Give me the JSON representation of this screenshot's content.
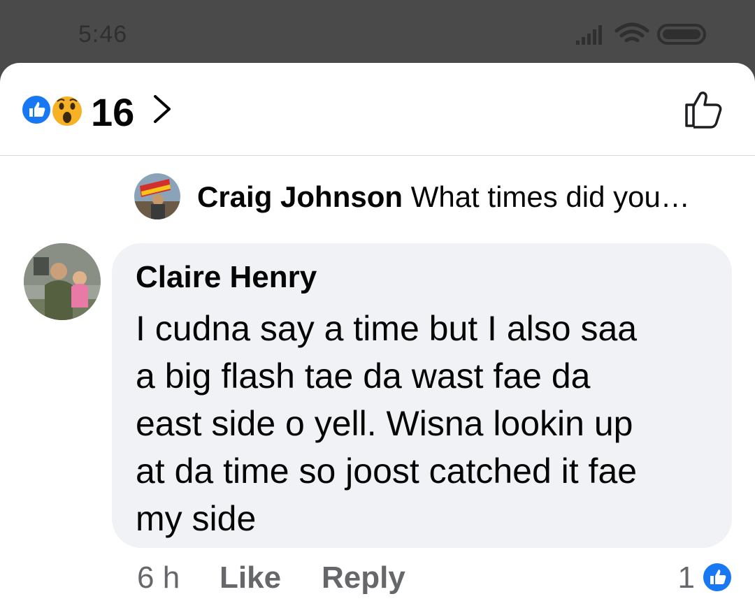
{
  "status_bar": {
    "time": "5:46"
  },
  "reactions": {
    "count": "16",
    "icons": [
      "like-icon",
      "wow-icon"
    ]
  },
  "parent_comment": {
    "author": "Craig Johnson",
    "snippet": "What times did you…"
  },
  "comment": {
    "author": "Claire Henry",
    "lines": [
      "I cudna say a time but I also saa",
      "a big flash tae da wast fae da",
      "east side o yell. Wisna lookin up",
      "at da time so joost catched it fae",
      "my side"
    ],
    "time_ago": "6 h",
    "like_label": "Like",
    "reply_label": "Reply",
    "reaction_count": "1"
  },
  "colors": {
    "like_blue": "#1877f2",
    "wow_yellow": "#f7b125",
    "bubble_bg": "#f0f2f5",
    "meta_gray": "#65676b"
  }
}
